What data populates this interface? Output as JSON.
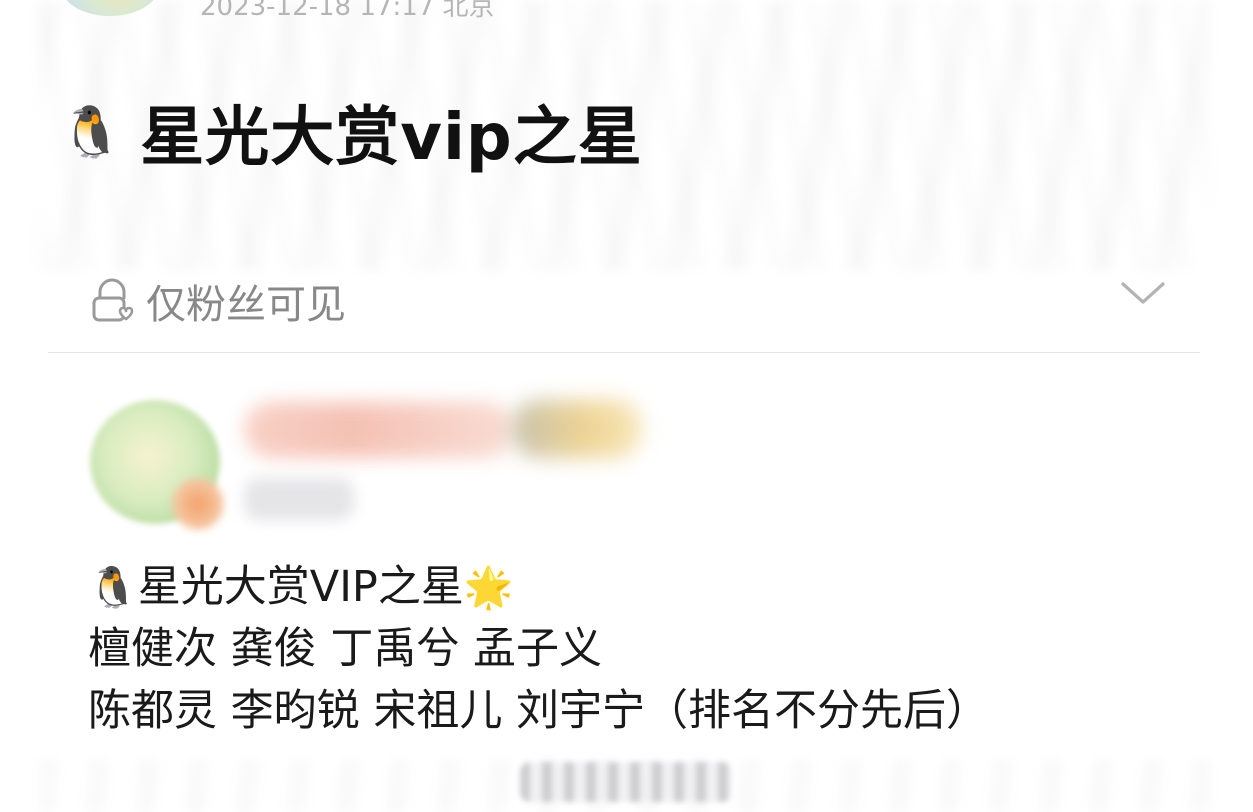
{
  "header": {
    "meta_text": "2023-12-18 17:17 北京"
  },
  "post_title": {
    "emoji": "🐧",
    "text": "星光大赏vip之星"
  },
  "visibility": {
    "label": "仅粉丝可见",
    "icon": "lock-heart-icon",
    "dropdown_icon": "chevron-down-icon"
  },
  "post": {
    "line1_emoji_start": "🐧",
    "line1_text": "星光大赏VIP之星",
    "line1_emoji_end": "🌟",
    "line2": "檀健次 龚俊 丁禹兮 孟子义",
    "line3": "陈都灵 李昀锐 宋祖儿 刘宇宁（排名不分先后）"
  },
  "colors": {
    "title": "#111111",
    "label_gray": "#888888",
    "divider": "#e6e6e6"
  }
}
